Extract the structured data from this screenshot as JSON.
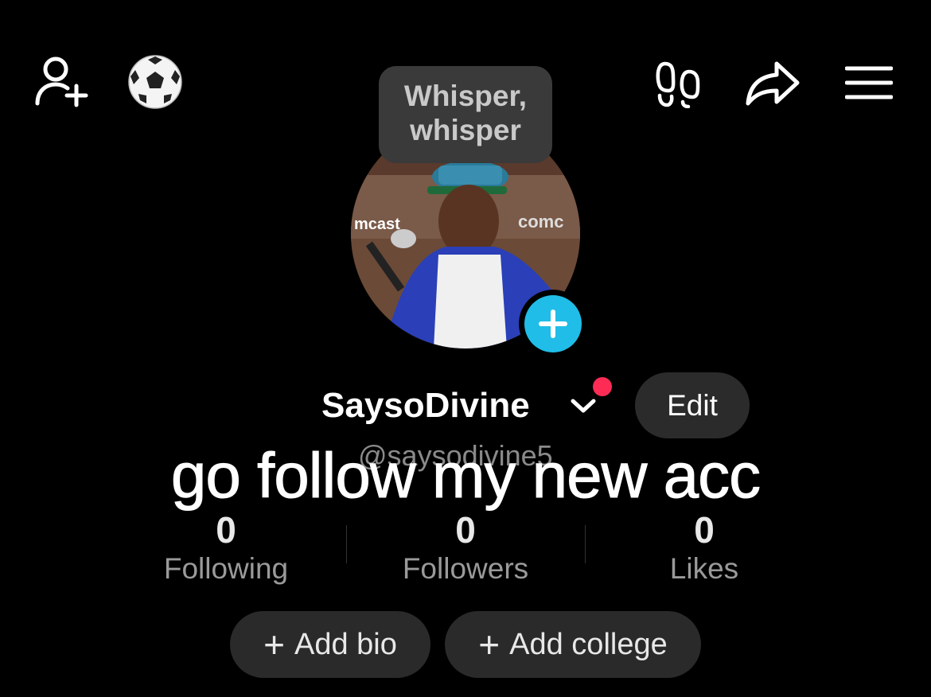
{
  "top_bar": {
    "add_friend_icon": "person-plus-icon",
    "emoji": "⚽",
    "footprints_icon": "footprints-icon",
    "share_icon": "share-arrow-icon",
    "menu_icon": "hamburger-menu-icon"
  },
  "tooltip": {
    "line1": "Whisper,",
    "line2": "whisper"
  },
  "profile": {
    "display_name": "SaysoDivine",
    "handle": "@saysodivine5",
    "edit_label": "Edit",
    "notification_dot_color": "#fe2c55",
    "avatar_add_color": "#20bde8",
    "photo_text_left": "mcast",
    "photo_text_right": "comc"
  },
  "caption_overlay": "go follow my new acc",
  "stats": [
    {
      "value": "0",
      "label": "Following"
    },
    {
      "value": "0",
      "label": "Followers"
    },
    {
      "value": "0",
      "label": "Likes"
    }
  ],
  "actions": {
    "add_bio": "Add bio",
    "add_college": "Add college"
  }
}
